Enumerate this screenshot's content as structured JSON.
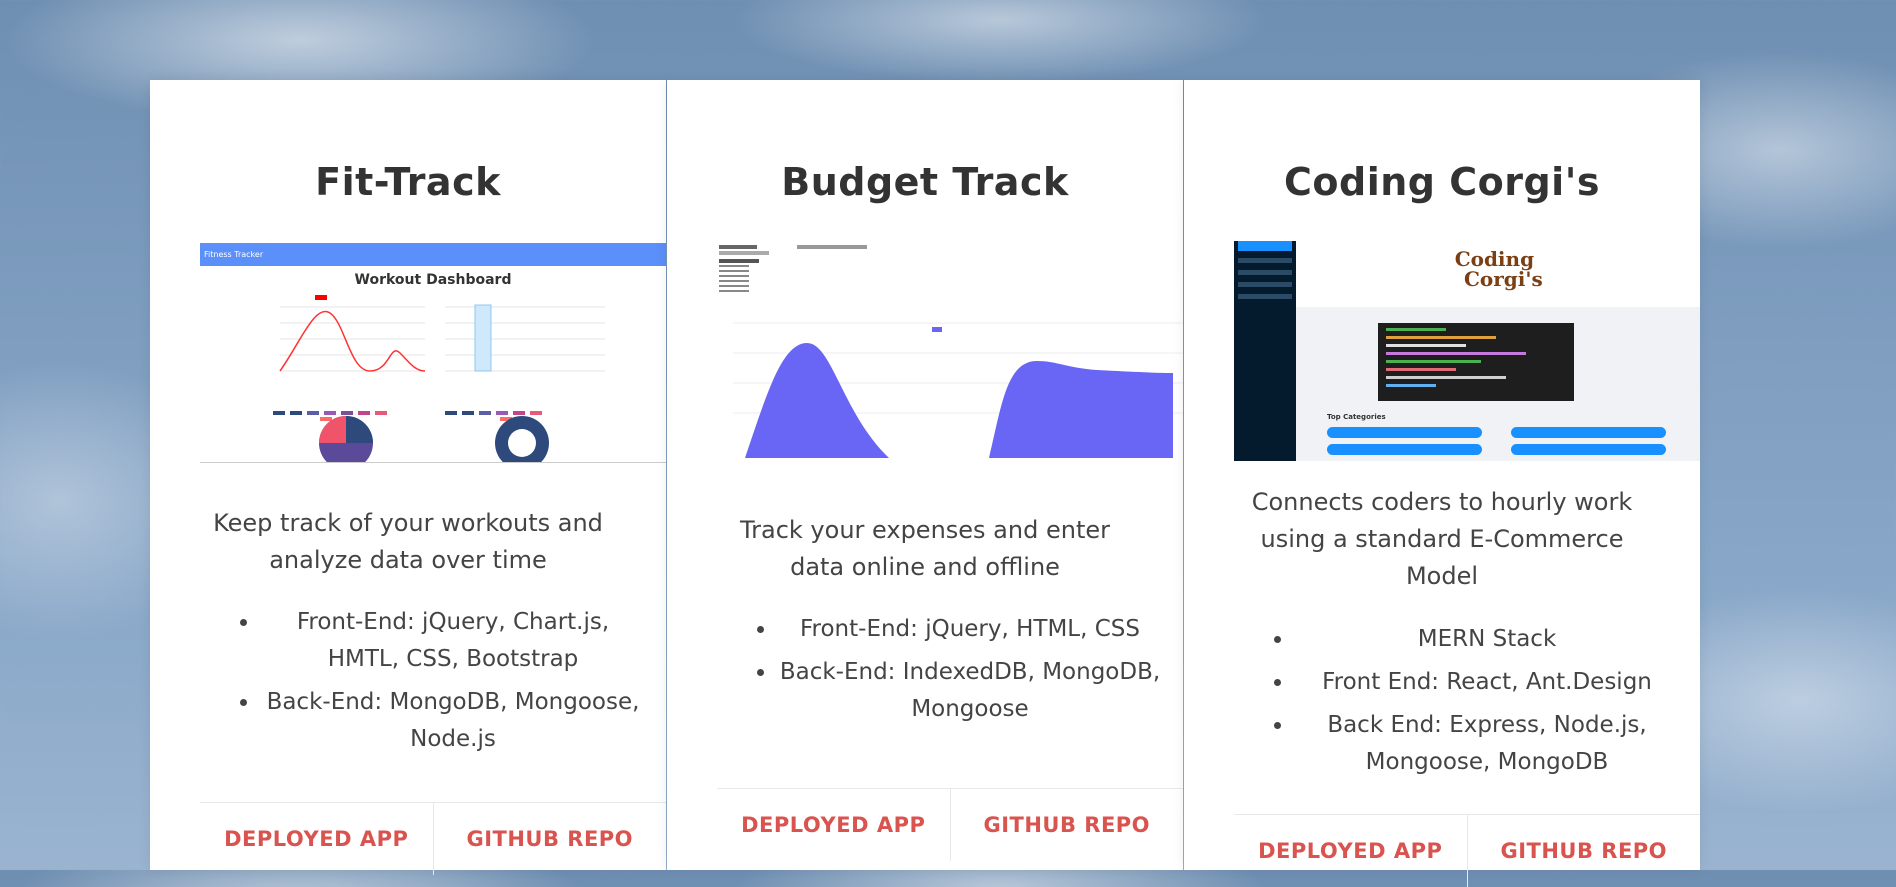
{
  "projects": [
    {
      "title": "Fit-Track",
      "description": "Keep track of your workouts and analyze data over time",
      "tech": [
        "Front-End: jQuery, Chart.js, HMTL, CSS, Bootstrap",
        "Back-End: MongoDB, Mongoose, Node.js"
      ],
      "deployed_label": "DEPLOYED APP",
      "github_label": "GITHUB REPO",
      "screenshot": {
        "nav_title": "Fitness Tracker",
        "heading": "Workout Dashboard"
      }
    },
    {
      "title": "Budget Track",
      "description": "Track your expenses and enter data online and offline",
      "tech": [
        "Front-End: jQuery, HTML, CSS",
        "Back-End: IndexedDB, MongoDB, Mongoose"
      ],
      "deployed_label": "DEPLOYED APP",
      "github_label": "GITHUB REPO"
    },
    {
      "title": "Coding Corgi's",
      "description": "Connects coders to hourly work using a standard E-Commerce Model",
      "tech": [
        "MERN Stack",
        "Front End: React, Ant.Design",
        "Back End: Express, Node.js, Mongoose, MongoDB"
      ],
      "deployed_label": "DEPLOYED APP",
      "github_label": "GITHUB REPO",
      "screenshot": {
        "logo_line1": "Coding",
        "logo_line2": "Corgi's",
        "categories_label": "Top Categories"
      }
    }
  ],
  "colors": {
    "link": "#d9534f",
    "chart_fill": "#6a66f5",
    "nav_blue": "#5b8ff9"
  }
}
